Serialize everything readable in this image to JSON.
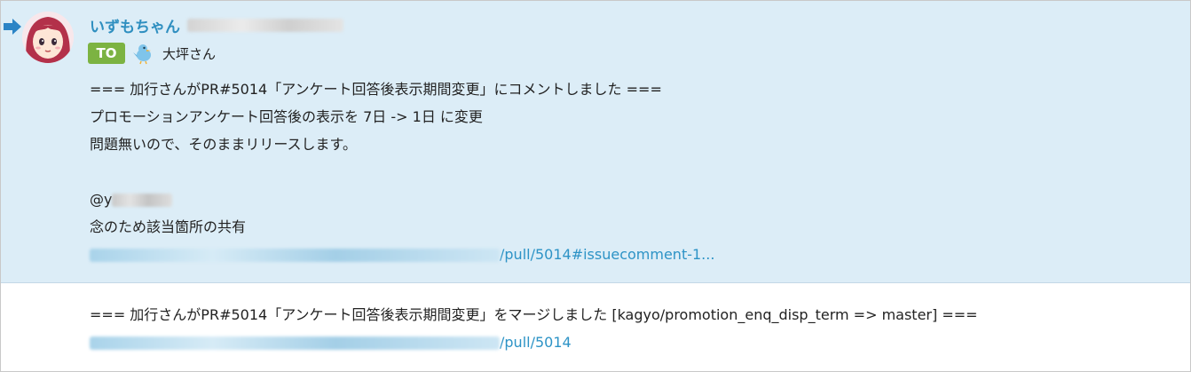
{
  "messages": [
    {
      "sender": {
        "name": "いずもちゃん"
      },
      "to_label": "TO",
      "recipient": {
        "name": "大坪さん"
      },
      "lines": [
        "=== 加行さんがPR#5014「アンケート回答後表示期間変更」にコメントしました ===",
        "プロモーションアンケート回答後の表示を 7日 -> 1日 に変更",
        "問題無いので、そのままリリースします。",
        "",
        "@y",
        "念のため該当箇所の共有"
      ],
      "link_suffix": "/pull/5014#issuecomment-1..."
    },
    {
      "line": "=== 加行さんがPR#5014「アンケート回答後表示期間変更」をマージしました [kagyo/promotion_enq_disp_term => master] ===",
      "link_suffix": "/pull/5014"
    }
  ],
  "icons": {
    "unread_marker": "arrow-right-icon",
    "sender_avatar": "anime-girl-avatar",
    "recipient_avatar": "blue-bird-icon"
  },
  "colors": {
    "highlight_bg": "#dcedf7",
    "link": "#2d93c6",
    "sender_name": "#2f8fc0",
    "to_badge": "#7cb342",
    "unread_arrow": "#2b84c6"
  }
}
